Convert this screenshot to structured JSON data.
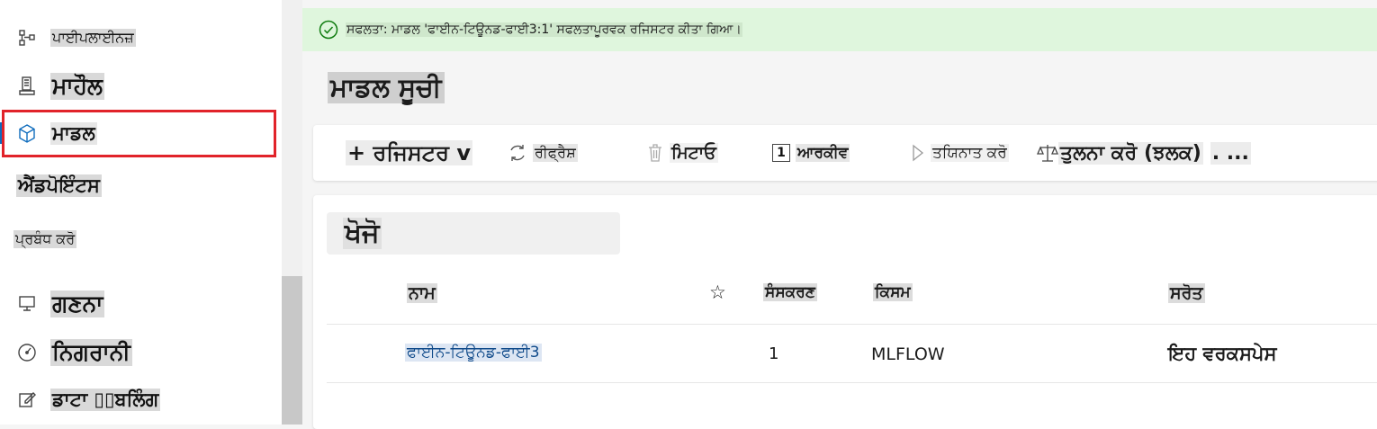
{
  "sidebar": {
    "items": [
      {
        "label": "ਪਾਈਪਲਾਈਨਜ਼",
        "icon": "pipelines-icon"
      },
      {
        "label": "ਮਾਹੌਲ",
        "icon": "environment-icon"
      },
      {
        "label": "ਮਾਡਲ",
        "icon": "cube-icon"
      },
      {
        "label": "ਐਂਡਪੋਇੰਟਸ",
        "icon": ""
      }
    ],
    "section_label": "ਪ੍ਰਬੰਧ ਕਰੋ",
    "manage_items": [
      {
        "label": "ਗਣਨਾ",
        "icon": "monitor-icon"
      },
      {
        "label": "ਨਿਗਰਾਨੀ",
        "icon": "gauge-icon"
      },
      {
        "label": "ਡਾਟਾ ▯▯ਬਲਿੰਗ",
        "icon": "edit-icon"
      }
    ]
  },
  "banner": {
    "text": "ਸਫਲਤਾ: ਮਾਡਲ 'ਫਾਈਨ-ਟਿਊਨਡ-ਫਾਈ3:1' ਸਫਲਤਾਪੂਰਵਕ ਰਜਿਸਟਰ ਕੀਤਾ ਗਿਆ।",
    "status_color": "#107c10"
  },
  "page": {
    "title": "ਮਾਡਲ ਸੂਚੀ"
  },
  "toolbar": {
    "register": "+ ਰਜਿਸਟਰ v",
    "refresh": "ਰੀਫ੍ਰੈਸ਼",
    "delete": "ਮਿਟਾਓ",
    "archive_badge": "1",
    "archive": "ਆਰਕੀਵ",
    "deploy": "ਤਯਿਨਾਤ ਕਰੋ",
    "compare": "ਤੁਲਨਾ ਕਰੋ (ਝਲਕ)",
    "more": ". ..."
  },
  "search": {
    "placeholder": "ਖੋਜੋ"
  },
  "table": {
    "headers": {
      "name": "ਨਾਮ",
      "favorite": "☆",
      "version": "ਸੰਸਕਰਣ",
      "type": "ਕਿਸਮ",
      "source": "ਸਰੋਤ"
    },
    "rows": [
      {
        "name": "ਫਾਈਨ-ਟਿਊਨਡ-ਫਾਈ3",
        "version": "1",
        "type": "MLFLOW",
        "source": "ਇਹ ਵਰਕਸਪੇਸ"
      }
    ]
  },
  "colors": {
    "accent": "#0f6cbd",
    "highlight_border": "#e1232a",
    "banner_bg": "#dff6dd"
  }
}
